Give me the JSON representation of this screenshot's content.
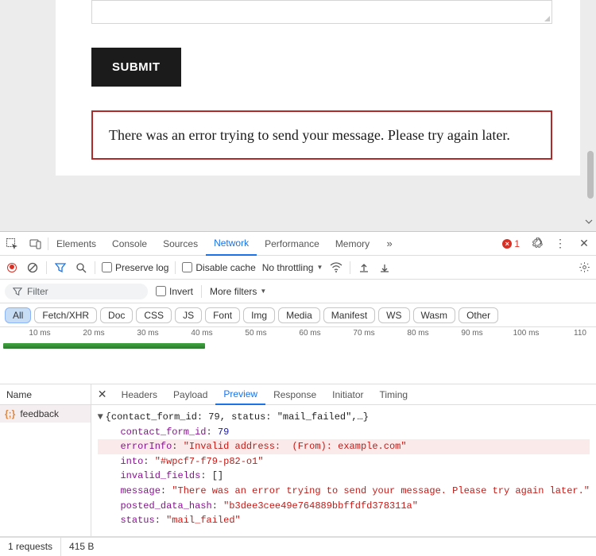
{
  "form": {
    "submit_label": "SUBMIT",
    "error_message": "There was an error trying to send your message. Please try again later."
  },
  "devtools": {
    "tabs": [
      "Elements",
      "Console",
      "Sources",
      "Network",
      "Performance",
      "Memory"
    ],
    "active_tab": "Network",
    "error_count": "1",
    "toolbar": {
      "preserve_log": "Preserve log",
      "disable_cache": "Disable cache",
      "throttling": "No throttling"
    },
    "filter": {
      "placeholder": "Filter",
      "invert": "Invert",
      "more_filters": "More filters"
    },
    "chips": [
      "All",
      "Fetch/XHR",
      "Doc",
      "CSS",
      "JS",
      "Font",
      "Img",
      "Media",
      "Manifest",
      "WS",
      "Wasm",
      "Other"
    ],
    "active_chip": "All",
    "timeline_ticks": [
      "10 ms",
      "20 ms",
      "30 ms",
      "40 ms",
      "50 ms",
      "60 ms",
      "70 ms",
      "80 ms",
      "90 ms",
      "100 ms",
      "110"
    ],
    "panel": {
      "name_header": "Name",
      "request_name": "feedback",
      "resp_tabs": [
        "Headers",
        "Payload",
        "Preview",
        "Response",
        "Initiator",
        "Timing"
      ],
      "active_resp_tab": "Preview"
    },
    "json": {
      "summary": "{contact_form_id: 79, status: \"mail_failed\",…}",
      "contact_form_id_key": "contact_form_id",
      "contact_form_id_val": "79",
      "errorInfo_key": "errorInfo",
      "errorInfo_val": "\"Invalid address:  (From): example.com\"",
      "into_key": "into",
      "into_val": "\"#wpcf7-f79-p82-o1\"",
      "invalid_fields_key": "invalid_fields",
      "invalid_fields_val": "[]",
      "message_key": "message",
      "message_val": "\"There was an error trying to send your message. Please try again later.\"",
      "posted_data_hash_key": "posted_data_hash",
      "posted_data_hash_val": "\"b3dee3cee49e764889bbffdfd378311a\"",
      "status_key": "status",
      "status_val": "\"mail_failed\""
    },
    "status_bar": {
      "requests": "1 requests",
      "size": "415 B"
    }
  }
}
